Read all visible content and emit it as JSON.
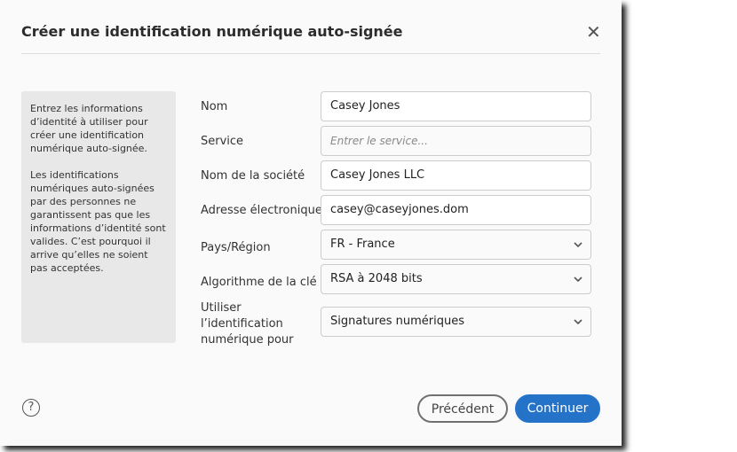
{
  "dialog": {
    "title": "Créer une identification numérique auto-signée",
    "close": "✕"
  },
  "info": {
    "p1": "Entrez les informations d’identité à utiliser pour créer une identification numérique auto-signée.",
    "p2": "Les identifications numériques auto-signées par des personnes ne garantissent pas que les informations d’identité sont valides. C’est pourquoi il arrive qu’elles ne soient pas acceptées."
  },
  "form": {
    "name_label": "Nom",
    "name_value": "Casey Jones",
    "service_label": "Service",
    "service_placeholder": "Entrer le service...",
    "company_label": "Nom de la société",
    "company_value": "Casey Jones LLC",
    "email_label": "Adresse électronique",
    "email_value": "casey@caseyjones.dom",
    "country_label": "Pays/Région",
    "country_value": "FR - France",
    "algo_label": "Algorithme de la clé",
    "algo_value": "RSA à 2048 bits",
    "usage_label": "Utiliser l’identification numérique pour",
    "usage_value": "Signatures numériques"
  },
  "footer": {
    "help": "?",
    "previous": "Précédent",
    "continue": "Continuer"
  }
}
